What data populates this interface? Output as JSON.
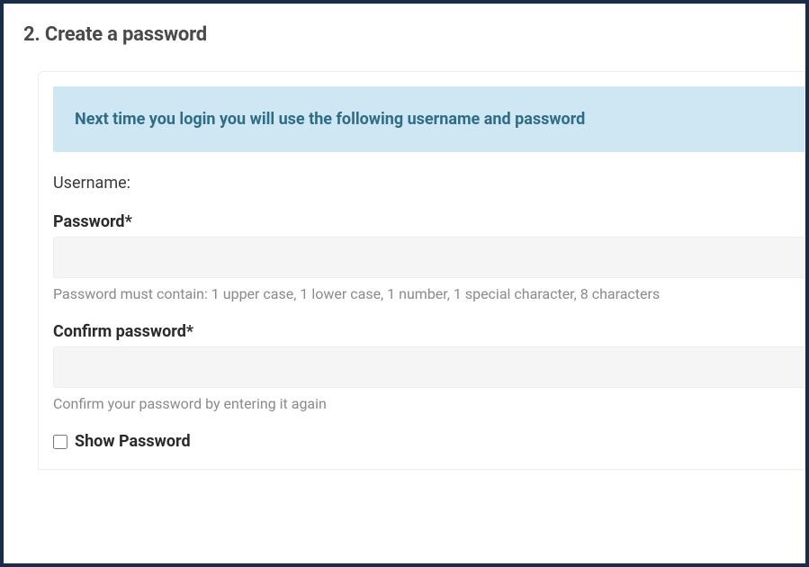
{
  "section": {
    "title": "2. Create a password"
  },
  "banner": {
    "text": "Next time you login you will use the following username and password"
  },
  "form": {
    "username_label": "Username:",
    "password": {
      "label": "Password*",
      "value": "",
      "hint": "Password must contain: 1 upper case, 1 lower case, 1 number, 1 special character, 8 characters"
    },
    "confirm_password": {
      "label": "Confirm password*",
      "value": "",
      "hint": "Confirm your password by entering it again"
    },
    "show_password_label": "Show Password"
  }
}
